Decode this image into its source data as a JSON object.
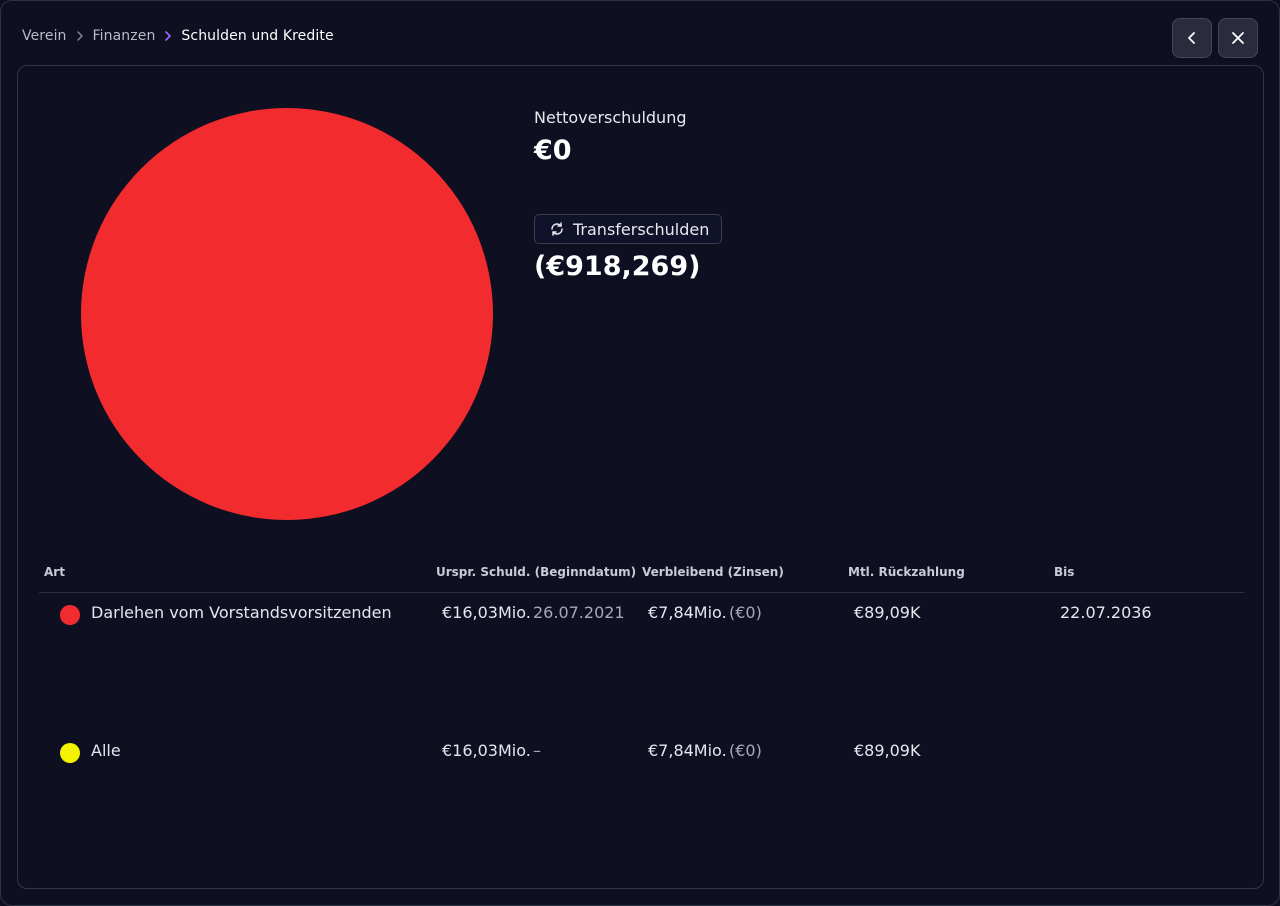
{
  "breadcrumb": {
    "items": [
      "Verein",
      "Finanzen",
      "Schulden und Kredite"
    ]
  },
  "header": {
    "back_icon": "chevron-left-icon",
    "close_icon": "close-icon"
  },
  "summary": {
    "net_debt_label": "Nettoverschuldung",
    "net_debt_value": "€0",
    "transfer_label": "Transferschulden",
    "transfer_icon": "refresh-icon",
    "transfer_value": "(€918,269)"
  },
  "chart_data": {
    "type": "pie",
    "slices": [
      {
        "label": "Darlehen vom Vorstandsvorsitzenden",
        "value": 100,
        "color": "#f22c2e"
      }
    ]
  },
  "table": {
    "headers": {
      "art": "Art",
      "original": "Urspr. Schuld. (Beginndatum)",
      "remaining": "Verbleibend (Zinsen)",
      "monthly": "Mtl. Rückzahlung",
      "until": "Bis"
    },
    "rows": [
      {
        "dot_color": "#f22c2e",
        "name": "Darlehen vom Vorstandsvorsitzenden",
        "original": "€16,03Mio.",
        "start_date": "26.07.2021",
        "remaining": "€7,84Mio.",
        "interest": "(€0)",
        "monthly": "€89,09K",
        "until": "22.07.2036"
      },
      {
        "dot_color": "#f3f300",
        "name": "Alle",
        "original": "€16,03Mio.",
        "start_date": "–",
        "remaining": "€7,84Mio.",
        "interest": "(€0)",
        "monthly": "€89,09K",
        "until": ""
      }
    ]
  },
  "colors": {
    "background": "#0e0f21",
    "pie_red": "#f22c2e",
    "accent_purple": "#9b6cff",
    "alle_yellow": "#f3f300"
  }
}
